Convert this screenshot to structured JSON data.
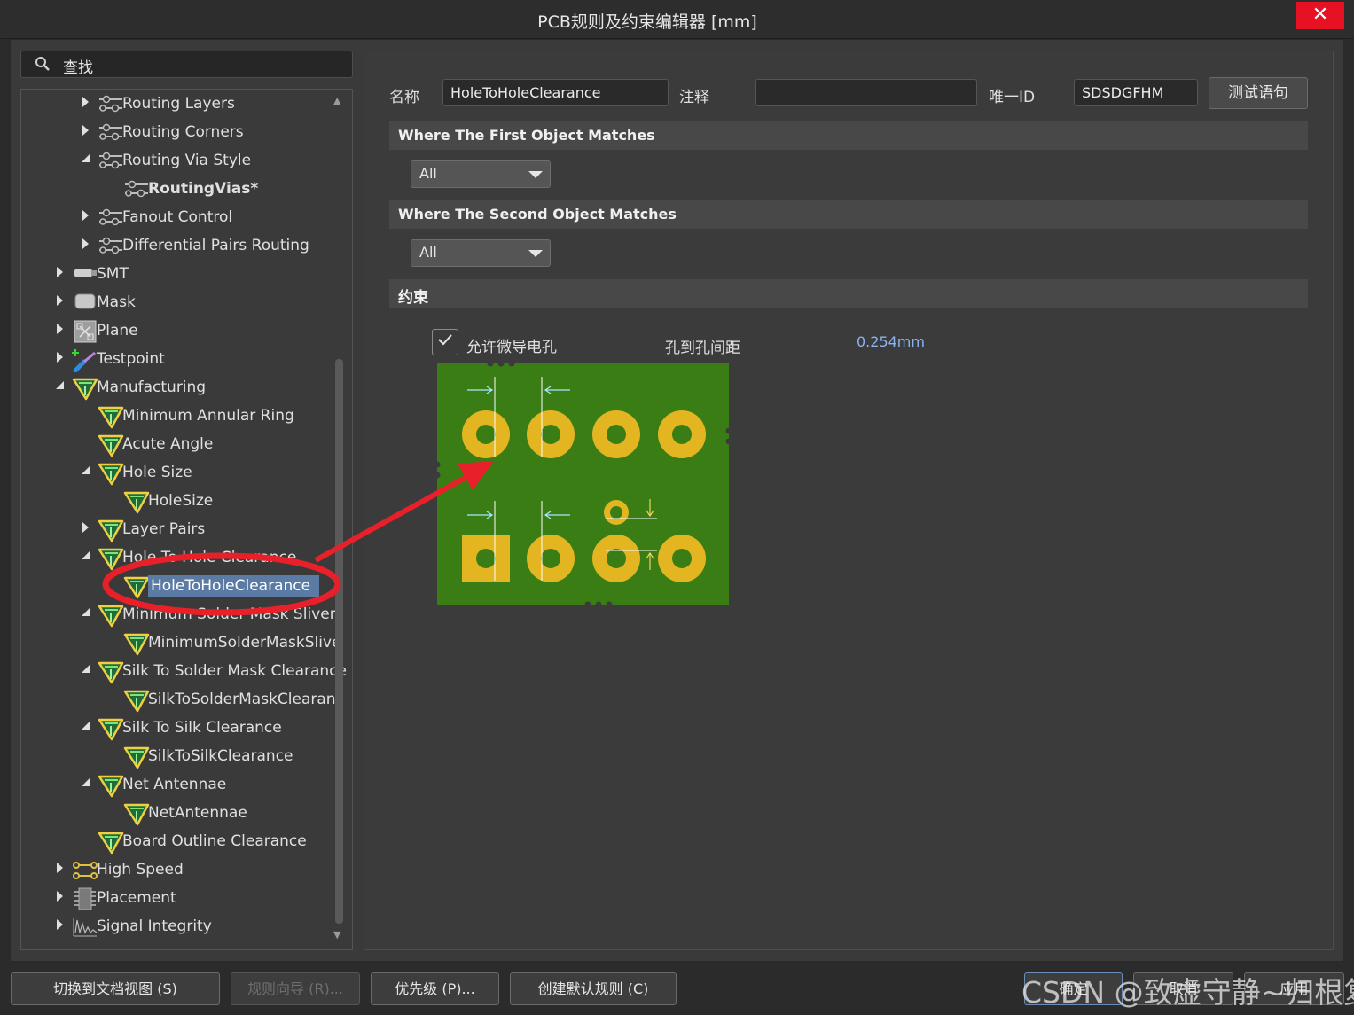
{
  "window": {
    "title": "PCB规则及约束编辑器 [mm]",
    "close_glyph": "✕"
  },
  "search": {
    "icon": "search-icon",
    "text": "查找"
  },
  "tree": {
    "items": [
      {
        "label": "Routing Layers",
        "icon": "routing-icon",
        "expand": "collapsed"
      },
      {
        "label": "Routing Corners",
        "icon": "routing-icon",
        "expand": "collapsed"
      },
      {
        "label": "Routing Via Style",
        "icon": "routing-icon",
        "expand": "expanded"
      },
      {
        "label": "RoutingVias*",
        "icon": "routing-icon",
        "expand": "none",
        "bold": true
      },
      {
        "label": "Fanout Control",
        "icon": "routing-icon",
        "expand": "collapsed"
      },
      {
        "label": "Differential Pairs Routing",
        "icon": "routing-icon",
        "expand": "collapsed"
      },
      {
        "label": "SMT",
        "icon": "smt-icon",
        "expand": "collapsed"
      },
      {
        "label": "Mask",
        "icon": "mask-icon",
        "expand": "collapsed"
      },
      {
        "label": "Plane",
        "icon": "plane-icon",
        "expand": "collapsed"
      },
      {
        "label": "Testpoint",
        "icon": "testpoint-icon",
        "expand": "collapsed"
      },
      {
        "label": "Manufacturing",
        "icon": "manufacturing-icon",
        "expand": "expanded"
      },
      {
        "label": "Minimum Annular Ring",
        "icon": "manufacturing-icon",
        "expand": "none"
      },
      {
        "label": "Acute Angle",
        "icon": "manufacturing-icon",
        "expand": "none"
      },
      {
        "label": "Hole Size",
        "icon": "manufacturing-icon",
        "expand": "expanded"
      },
      {
        "label": "HoleSize",
        "icon": "manufacturing-icon",
        "expand": "none"
      },
      {
        "label": "Layer Pairs",
        "icon": "manufacturing-icon",
        "expand": "collapsed"
      },
      {
        "label": "Hole To Hole Clearance",
        "icon": "manufacturing-icon",
        "expand": "expanded"
      },
      {
        "label": "HoleToHoleClearance",
        "icon": "manufacturing-icon",
        "expand": "none",
        "selected": true
      },
      {
        "label": "Minimum Solder Mask Sliver",
        "icon": "manufacturing-icon",
        "expand": "expanded"
      },
      {
        "label": "MinimumSolderMaskSlive",
        "icon": "manufacturing-icon",
        "expand": "none"
      },
      {
        "label": "Silk To Solder Mask Clearance",
        "icon": "manufacturing-icon",
        "expand": "expanded"
      },
      {
        "label": "SilkToSolderMaskClearanc",
        "icon": "manufacturing-icon",
        "expand": "none"
      },
      {
        "label": "Silk To Silk Clearance",
        "icon": "manufacturing-icon",
        "expand": "expanded"
      },
      {
        "label": "SilkToSilkClearance",
        "icon": "manufacturing-icon",
        "expand": "none"
      },
      {
        "label": "Net Antennae",
        "icon": "manufacturing-icon",
        "expand": "expanded"
      },
      {
        "label": "NetAntennae",
        "icon": "manufacturing-icon",
        "expand": "none"
      },
      {
        "label": "Board Outline Clearance",
        "icon": "manufacturing-icon",
        "expand": "none"
      },
      {
        "label": "High Speed",
        "icon": "highspeed-icon",
        "expand": "collapsed"
      },
      {
        "label": "Placement",
        "icon": "placement-icon",
        "expand": "collapsed"
      },
      {
        "label": "Signal Integrity",
        "icon": "signal-integrity-icon",
        "expand": "collapsed"
      }
    ]
  },
  "rule": {
    "name_label": "名称",
    "name_value": "HoleToHoleClearance",
    "comment_label": "注释",
    "comment_value": "",
    "uid_label": "唯一ID",
    "uid_value": "SDSDGFHM",
    "test_button": "测试语句"
  },
  "first_match": {
    "header": "Where The First Object Matches",
    "value": "All"
  },
  "second_match": {
    "header": "Where The Second Object Matches",
    "value": "All"
  },
  "constraints": {
    "header": "约束",
    "allow_micro_via_label": "允许微导电孔",
    "allow_micro_via_checked": true,
    "clearance_label": "孔到孔间距",
    "clearance_value": "0.254mm"
  },
  "footer": {
    "switch_view": "切换到文档视图 (S)",
    "rule_wizard": "规则向导 (R)...",
    "priority": "优先级 (P)...",
    "create_default": "创建默认规则 (C)",
    "ok": "确定",
    "cancel": "取消",
    "apply": "应用"
  },
  "watermark": "CSDN @致虚守静~归根复命",
  "colors": {
    "board_green": "#3a7d14",
    "pad_gold": "#e2b521",
    "annotation_red": "#e8202a",
    "selection_blue": "#5b7aa4",
    "value_blue": "#8ab4f0"
  }
}
